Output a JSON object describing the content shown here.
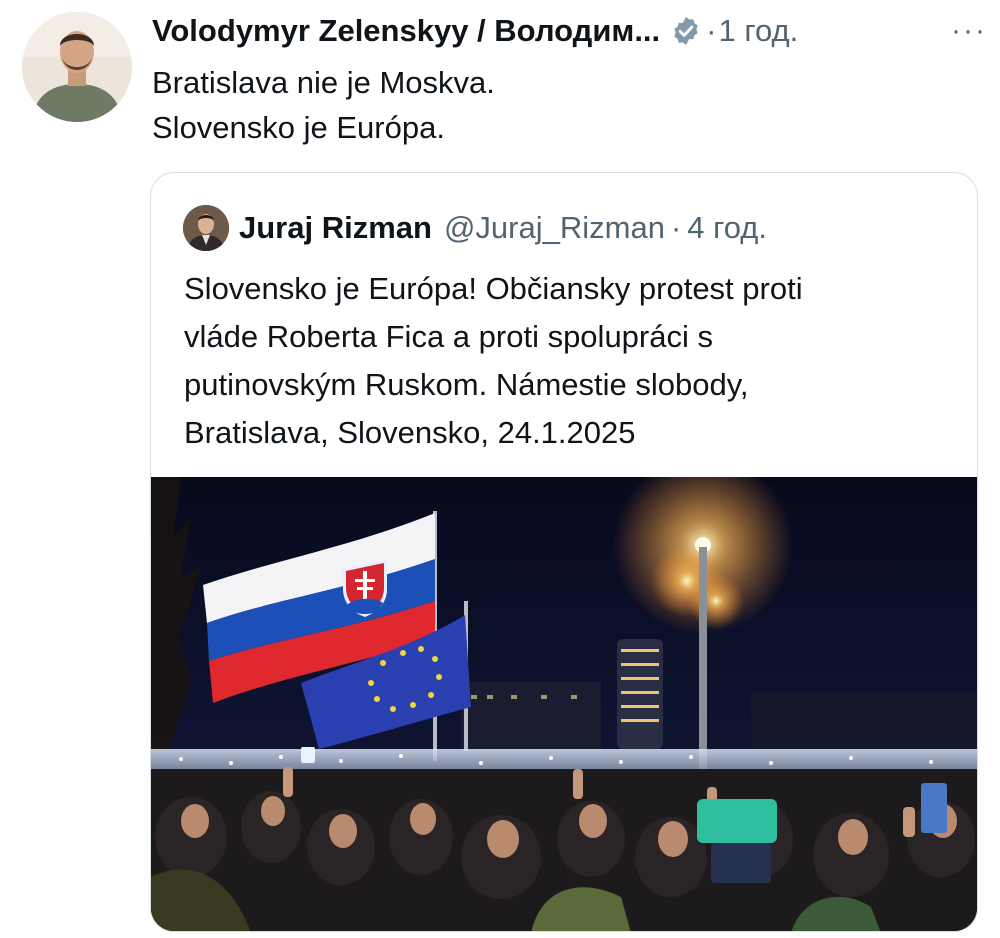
{
  "tweet": {
    "author_name": "Volodymyr Zelenskyy / Володим...",
    "time_separator": "·",
    "time": "1 год.",
    "more_label": "···",
    "verified_icon": "verified-badge-icon",
    "lines": [
      "Bratislava nie je Moskva.",
      "Slovensko je Európa."
    ]
  },
  "quote": {
    "author_name": "Juraj Rizman",
    "handle": "@Juraj_Rizman",
    "time_separator": "·",
    "time": "4 год.",
    "lines": [
      "Slovensko je Európa! Občiansky protest proti",
      "vláde Roberta Fica a proti spolupráci s",
      "putinovským Ruskom. Námestie slobody,",
      "Bratislava, Slovensko, 24.1.2025"
    ]
  },
  "colors": {
    "text_primary": "#0f1419",
    "text_secondary": "#536471",
    "verified_gray": "#829aab",
    "border": "#d6dce1"
  }
}
